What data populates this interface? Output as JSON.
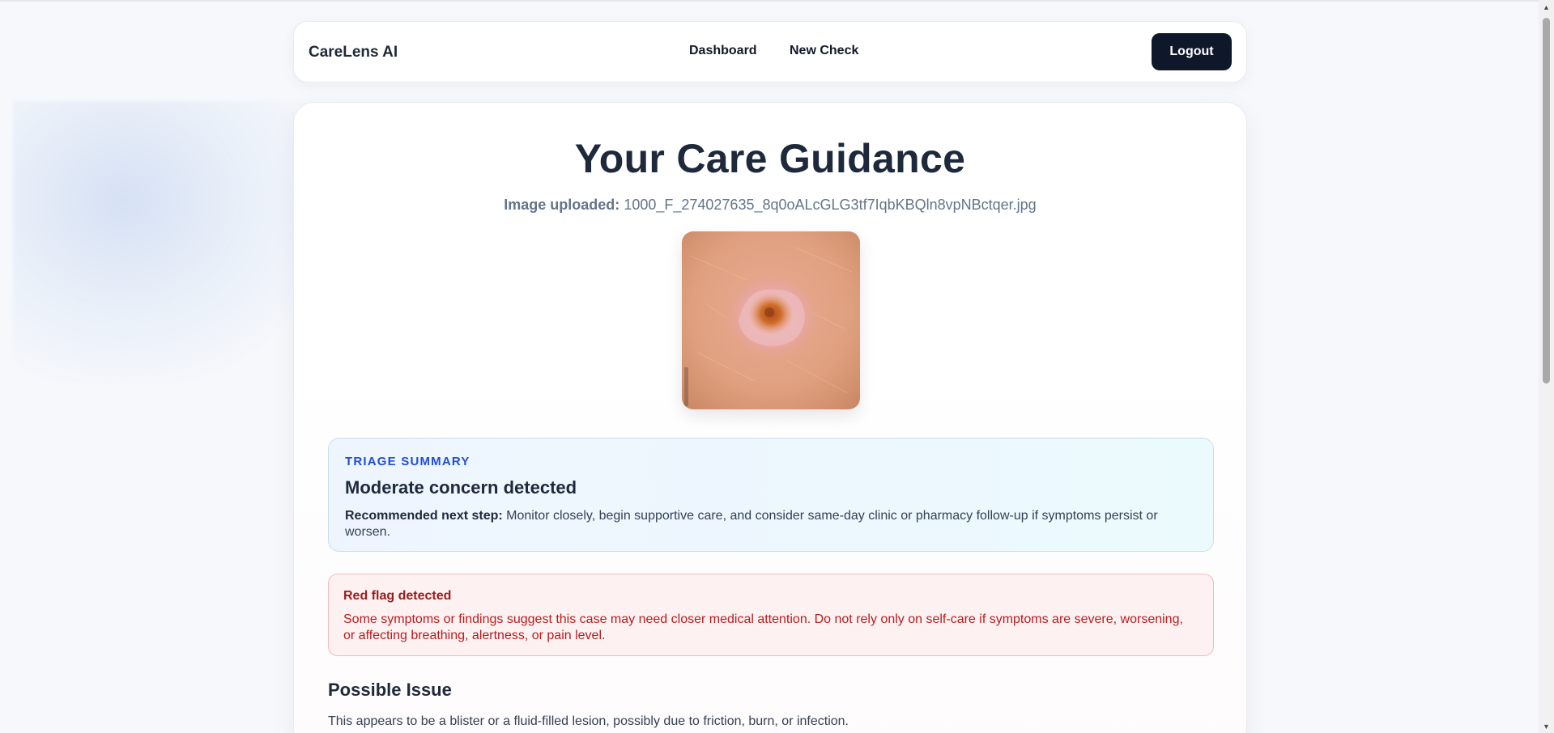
{
  "nav": {
    "brand": "CareLens AI",
    "links": [
      "Dashboard",
      "New Check"
    ],
    "logout_label": "Logout"
  },
  "page": {
    "title": "Your Care Guidance",
    "upload_label": "Image uploaded:",
    "upload_filename": "1000_F_274027635_8q0oALcGLG3tf7IqbKBQln8vpNBctqer.jpg"
  },
  "triage": {
    "label": "TRIAGE SUMMARY",
    "heading": "Moderate concern detected",
    "step_label": "Recommended next step:",
    "step_text": "Monitor closely, begin supportive care, and consider same-day clinic or pharmacy follow-up if symptoms persist or worsen."
  },
  "red_flag": {
    "title": "Red flag detected",
    "text": "Some symptoms or findings suggest this case may need closer medical attention. Do not rely only on self-care if symptoms are severe, worsening, or affecting breathing, alertness, or pain level."
  },
  "possible_issue": {
    "title": "Possible Issue",
    "text": "This appears to be a blister or a fluid-filled lesion, possibly due to friction, burn, or infection."
  },
  "colors": {
    "primary_dark": "#0f172a",
    "triage_accent": "#1d4ed8",
    "red_flag": "#b91c1c"
  }
}
